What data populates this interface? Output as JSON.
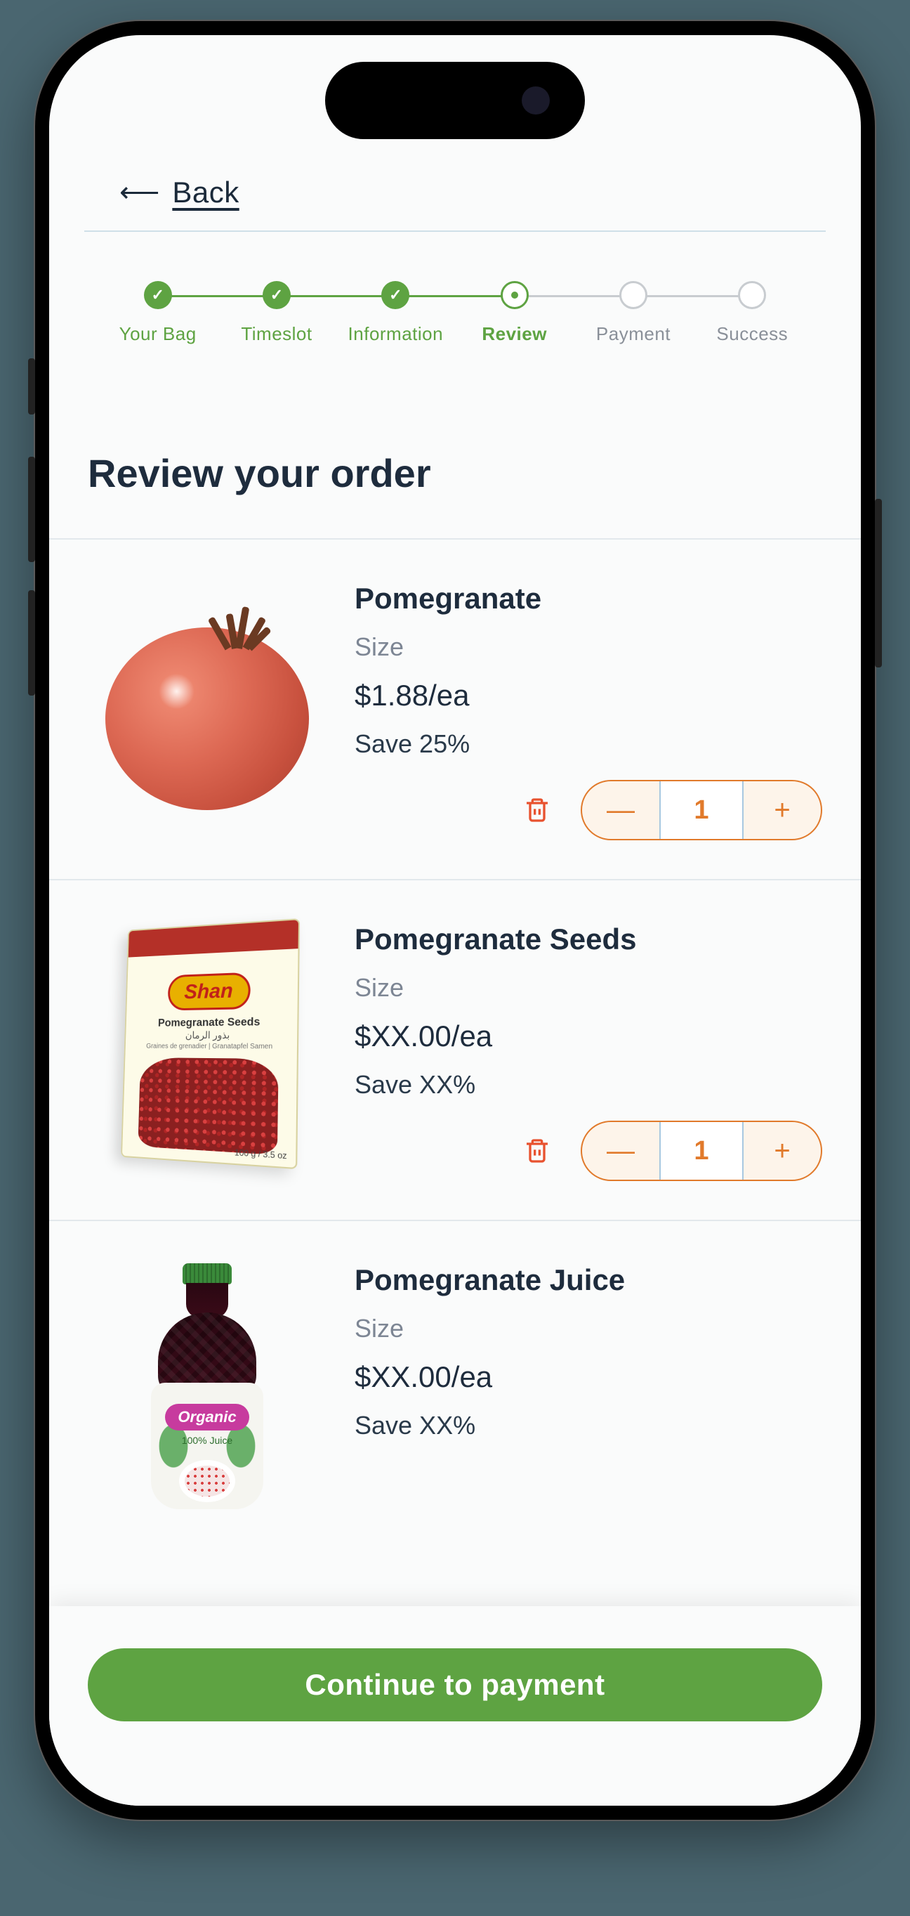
{
  "back_label": "Back",
  "stepper": {
    "steps": [
      {
        "label": "Your Bag",
        "state": "done"
      },
      {
        "label": "Timeslot",
        "state": "done"
      },
      {
        "label": "Information",
        "state": "done"
      },
      {
        "label": "Review",
        "state": "current"
      },
      {
        "label": "Payment",
        "state": "pending"
      },
      {
        "label": "Success",
        "state": "pending"
      }
    ]
  },
  "heading": "Review your order",
  "items": [
    {
      "name": "Pomegranate",
      "size_label": "Size",
      "price": "$1.88/ea",
      "savings": "Save 25%",
      "quantity": "1"
    },
    {
      "name": "Pomegranate Seeds",
      "size_label": "Size",
      "price": "$XX.00/ea",
      "savings": "Save XX%",
      "quantity": "1",
      "package": {
        "brand": "Shan",
        "product": "Pomegranate Seeds",
        "weight": "100 g / 3.5 oz"
      }
    },
    {
      "name": "Pomegranate Juice",
      "size_label": "Size",
      "price": "$XX.00/ea",
      "savings": "Save XX%",
      "bottle": {
        "badge": "Organic",
        "sub": "100% Juice"
      }
    }
  ],
  "qty_minus": "—",
  "qty_plus": "+",
  "cta": "Continue to payment"
}
